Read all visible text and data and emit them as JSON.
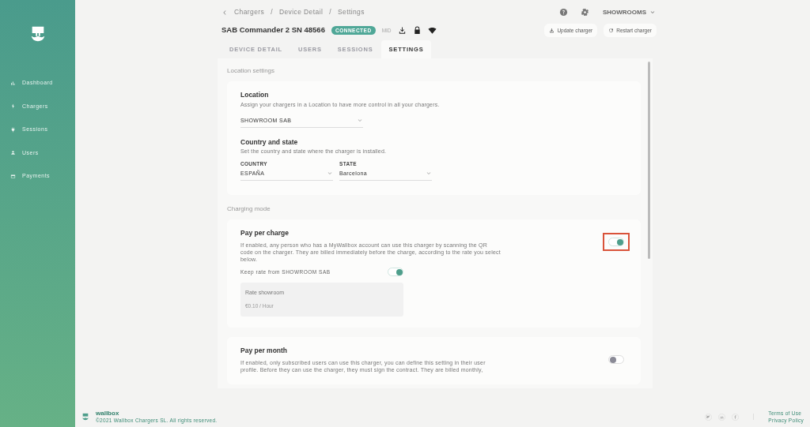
{
  "sidebar": {
    "items": [
      {
        "label": "Dashboard"
      },
      {
        "label": "Chargers"
      },
      {
        "label": "Sessions"
      },
      {
        "label": "Users"
      },
      {
        "label": "Payments"
      }
    ]
  },
  "breadcrumb": [
    {
      "label": "Chargers"
    },
    {
      "separator": "/",
      "label": "Device Detail"
    },
    {
      "separator": "/",
      "label": "Settings"
    }
  ],
  "account": "SHOWROOMS",
  "charger": {
    "name": "SAB Commander 2 SN 48566",
    "status": "CONNECTED",
    "mid": "MID"
  },
  "actions": [
    {
      "label": "Update charger"
    },
    {
      "label": "Restart charger"
    }
  ],
  "tabs": [
    {
      "label": "DEVICE DETAIL",
      "selected": false
    },
    {
      "label": "USERS",
      "selected": false
    },
    {
      "label": "SESSIONS",
      "selected": false
    },
    {
      "label": "SETTINGS",
      "selected": true
    }
  ],
  "location_settings": {
    "heading": "Location settings",
    "location_title": "Location",
    "location_text": "Assign your chargers in a Location to have more control in all your chargers.",
    "location_value": "SHOWROOM SAB",
    "country_title": "Country and state",
    "country_text": "Set the country and state where the charger is installed.",
    "country_label": "COUNTRY",
    "country_value": "ESPAÑA",
    "state_label": "STATE",
    "state_value": "Barcelona"
  },
  "charging_mode": {
    "heading": "Charging mode",
    "modes": [
      {
        "title": "Pay per charge",
        "text": "If enabled, any person who has a MyWallbox account can use this charger by scanning the QR code on the charger. They are billed immediately before the charge, according to the rate you select below.",
        "on": true,
        "highlighted": true,
        "keep_rate": {
          "label": "Keep rate from SHOWROOM SAB",
          "on": true
        },
        "rate": {
          "name": "Rate showroom",
          "price": "€0.10 / Hour"
        }
      },
      {
        "title": "Pay per month",
        "text": "If enabled, only subscribed users can use this charger, you can define this setting in their user profile. Before they can use the charger, they must sign the contract. They are billed monthly,",
        "on": false,
        "highlighted": false
      }
    ]
  },
  "footer": {
    "brand": "wallbox",
    "copyright": "©2021 Wallbox Chargers SL. All rights reserved.",
    "links": [
      "Terms of Use",
      "Privacy Policy"
    ]
  }
}
